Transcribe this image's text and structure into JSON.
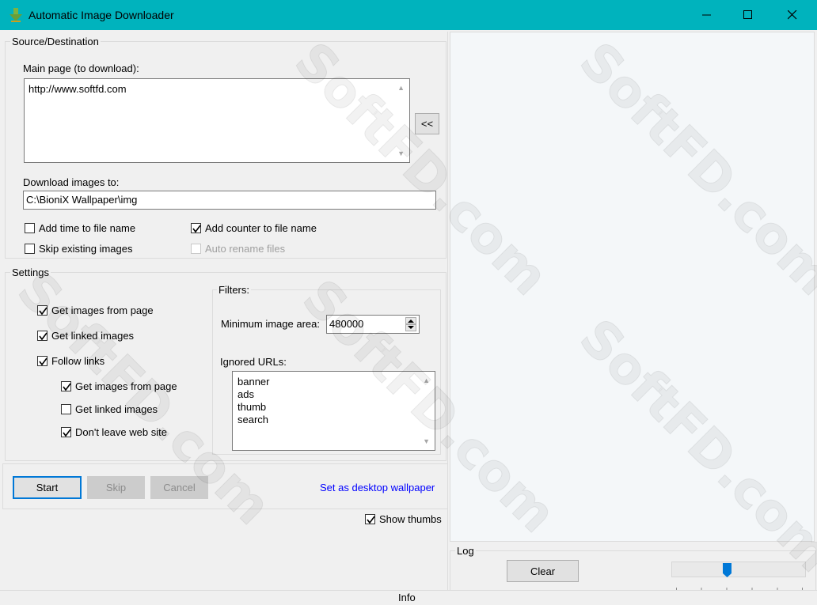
{
  "window": {
    "title": "Automatic Image Downloader",
    "title_bar_color": "#00b3bd",
    "controls": {
      "minimize": "minimize-icon",
      "maximize": "maximize-icon",
      "close": "close-icon"
    }
  },
  "source": {
    "group_label": "Source/Destination",
    "main_page_label": "Main page (to download):",
    "main_page_value": "http://www.softfd.com",
    "back_button": "<<",
    "download_label": "Download images to:",
    "download_value": "C:\\BioniX Wallpaper\\img",
    "options": {
      "add_time": {
        "label": "Add time to file name",
        "checked": false
      },
      "add_counter": {
        "label": "Add counter to file name",
        "checked": true
      },
      "skip_existing": {
        "label": "Skip existing images",
        "checked": false
      },
      "auto_rename": {
        "label": "Auto rename files",
        "checked": false,
        "disabled": true
      }
    }
  },
  "settings": {
    "group_label": "Settings",
    "get_images": {
      "label": "Get images from page",
      "checked": true
    },
    "get_linked": {
      "label": "Get linked images",
      "checked": true
    },
    "follow_links": {
      "label": "Follow links",
      "checked": true
    },
    "sub_get_images": {
      "label": "Get images from page",
      "checked": true
    },
    "sub_get_linked": {
      "label": "Get linked images",
      "checked": false
    },
    "dont_leave": {
      "label": "Don't leave web site",
      "checked": true
    },
    "filters": {
      "group_label": "Filters:",
      "min_area_label": "Minimum image area:",
      "min_area_value": "480000",
      "ignored_label": "Ignored URLs:",
      "ignored_urls": [
        "banner",
        "ads",
        "thumb",
        "search"
      ]
    }
  },
  "actions": {
    "start": "Start",
    "skip": "Skip",
    "cancel": "Cancel",
    "wallpaper_link": "Set as desktop wallpaper",
    "link_color": "#0000ff",
    "show_thumbs": {
      "label": "Show thumbs",
      "checked": true
    }
  },
  "log": {
    "group_label": "Log",
    "clear": "Clear",
    "slider_position": 0.4
  },
  "status": {
    "info": "Info"
  },
  "watermark": {
    "text": "SoftFD.com"
  }
}
